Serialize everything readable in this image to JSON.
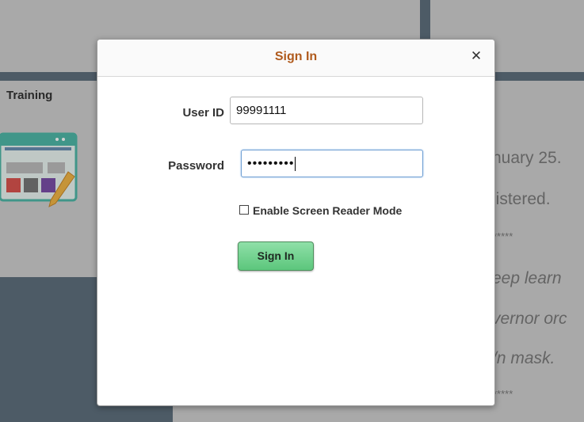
{
  "background": {
    "tile_title": "Training",
    "fragments": [
      "nuary 25.",
      "jistered.",
      "*****",
      "eep learn",
      "vernor orc",
      "/n mask.",
      "*****"
    ]
  },
  "modal": {
    "title": "Sign In",
    "close_symbol": "✕",
    "user_id": {
      "label": "User ID",
      "value": "99991111"
    },
    "password": {
      "label": "Password",
      "masked_value": "•••••••••"
    },
    "screen_reader": {
      "label": "Enable Screen Reader Mode",
      "checked": false
    },
    "sign_in_button": "Sign In"
  }
}
